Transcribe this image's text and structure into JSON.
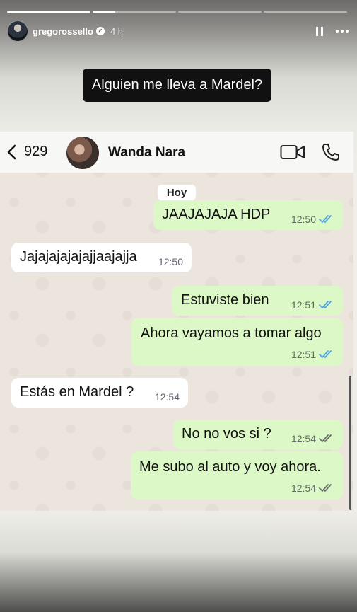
{
  "story": {
    "progress": [
      1.0,
      0.27,
      0,
      0
    ],
    "username": "gregorossello",
    "time": "4 h"
  },
  "caption": "Alguien me lleva a Mardel?",
  "chat": {
    "back_count": "929",
    "contact_name": "Wanda Nara",
    "date_chip": "Hoy",
    "messages": [
      {
        "text": "JAAJAJAJA HDP",
        "time": "12:50",
        "ticks": "read"
      },
      {
        "text": "Jajajajajajajjaajajja",
        "time": "12:50"
      },
      {
        "text": "Estuviste bien",
        "time": "12:51",
        "ticks": "read"
      },
      {
        "text": "Ahora vayamos a tomar algo",
        "time": "12:51",
        "ticks": "read"
      },
      {
        "text": "Estás en Mardel ?",
        "time": "12:54"
      },
      {
        "text": "No no vos si ?",
        "time": "12:54",
        "ticks": "delivered"
      },
      {
        "text": "Me subo al auto y voy ahora.",
        "time": "12:54",
        "ticks": "delivered"
      }
    ]
  },
  "colors": {
    "outgoing_bubble": "#dcf8c6",
    "incoming_bubble": "#ffffff",
    "read_ticks": "#4fa3e3",
    "delivered_ticks": "#6b6b6b"
  }
}
